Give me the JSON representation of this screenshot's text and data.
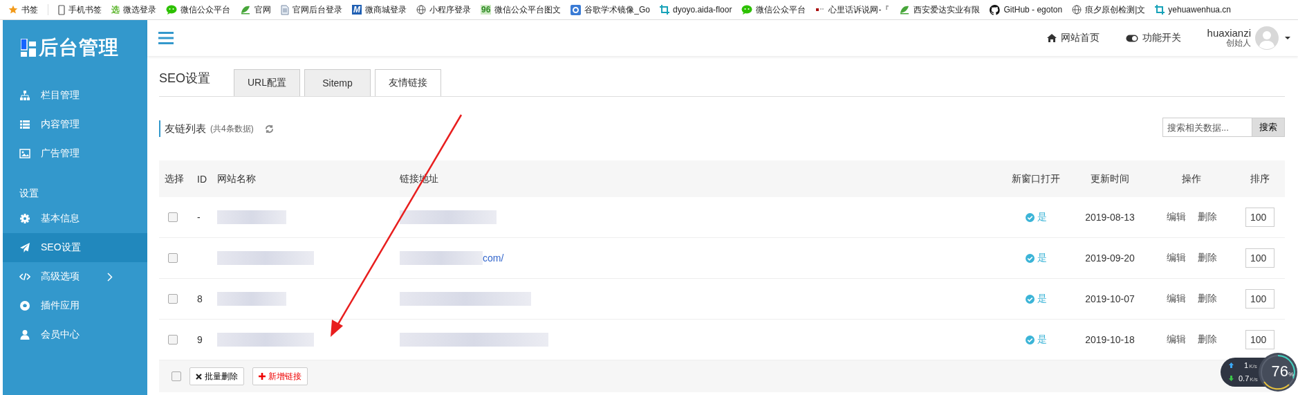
{
  "bookmarks": [
    {
      "kind": "star",
      "label": "书签"
    },
    {
      "kind": "phone",
      "label": "手机书签"
    },
    {
      "kind": "text-green",
      "icon_text": "选",
      "label": "微选登录"
    },
    {
      "kind": "chat",
      "label": "微信公众平台"
    },
    {
      "kind": "leaf",
      "label": "官网"
    },
    {
      "kind": "doc",
      "label": "官网后台登录"
    },
    {
      "kind": "text-blue",
      "icon_text": "M",
      "label": "微商城登录"
    },
    {
      "kind": "globe",
      "label": "小程序登录"
    },
    {
      "kind": "text-lime",
      "icon_text": "96",
      "label": "微信公众平台图文"
    },
    {
      "kind": "app",
      "label": "谷歌学术镜像_Go"
    },
    {
      "kind": "crop",
      "label": "dyoyo.aida-floor"
    },
    {
      "kind": "chat",
      "label": "微信公众平台"
    },
    {
      "kind": "dots",
      "label": "心里话诉说网-『"
    },
    {
      "kind": "leaf",
      "label": "西安爱达实业有限"
    },
    {
      "kind": "github",
      "label": "GitHub - egoton"
    },
    {
      "kind": "globe",
      "label": "痕夕原创检测|文"
    },
    {
      "kind": "crop",
      "label": "yehuawenhua.cn"
    }
  ],
  "sidebar": {
    "logo": "后台管理",
    "items": [
      {
        "kind": "item",
        "label": "栏目管理",
        "selected": false
      },
      {
        "kind": "item",
        "label": "内容管理",
        "selected": false
      },
      {
        "kind": "item",
        "label": "广告管理",
        "selected": false
      },
      {
        "kind": "heading",
        "label": "设置"
      },
      {
        "kind": "item",
        "label": "基本信息",
        "selected": false
      },
      {
        "kind": "item",
        "label": "SEO设置",
        "selected": true
      },
      {
        "kind": "item",
        "label": "高级选项",
        "selected": false,
        "has_children": true
      },
      {
        "kind": "item",
        "label": "插件应用",
        "selected": false
      },
      {
        "kind": "item",
        "label": "会员中心",
        "selected": false
      }
    ]
  },
  "header": {
    "links": [
      {
        "label": "网站首页"
      },
      {
        "label": "功能开关"
      }
    ],
    "user": {
      "name": "huaxianzi",
      "role": "创始人"
    }
  },
  "page": {
    "title": "SEO设置",
    "tabs": [
      {
        "label": "URL配置",
        "selected": false
      },
      {
        "label": "Sitemp",
        "selected": false
      },
      {
        "label": "友情链接",
        "selected": true
      }
    ]
  },
  "list": {
    "title": "友链列表",
    "count": "(共4条数据)",
    "search": {
      "placeholder": "搜索相关数据...",
      "button": "搜索"
    },
    "columns": [
      "选择",
      "ID",
      "网站名称",
      "链接地址",
      "新窗口打开",
      "更新时间",
      "操作",
      "排序"
    ],
    "rows": [
      {
        "checked": false,
        "id": "-",
        "name_blurred": true,
        "link_blurred": true,
        "new_window": "是",
        "updated": "2019-08-13",
        "edit": "编辑",
        "delete": "删除",
        "sort": "100"
      },
      {
        "checked": false,
        "name_blurred": true,
        "link": "com/",
        "link_blurred": true,
        "new_window": "是",
        "updated": "2019-09-20",
        "edit": "编辑",
        "delete": "删除",
        "sort": "100"
      },
      {
        "checked": false,
        "id": "8",
        "name_blurred": true,
        "link_blurred": true,
        "new_window": "是",
        "updated": "2019-10-07",
        "edit": "编辑",
        "delete": "删除",
        "sort": "100"
      },
      {
        "checked": false,
        "id": "9",
        "name_blurred": true,
        "link_blurred": true,
        "new_window": "是",
        "updated": "2019-10-18",
        "edit": "编辑",
        "delete": "删除",
        "sort": "100"
      }
    ],
    "footer": {
      "checked": false,
      "buttons": [
        {
          "kind": "delete",
          "label": "批量删除"
        },
        {
          "kind": "add",
          "label": "新增链接"
        }
      ]
    }
  },
  "speed_widget": {
    "up": "1",
    "up_unit": "K/s",
    "down": "0.7",
    "down_unit": "K/s",
    "percent": "76",
    "percent_unit": "%"
  },
  "annotation_arrow": true
}
